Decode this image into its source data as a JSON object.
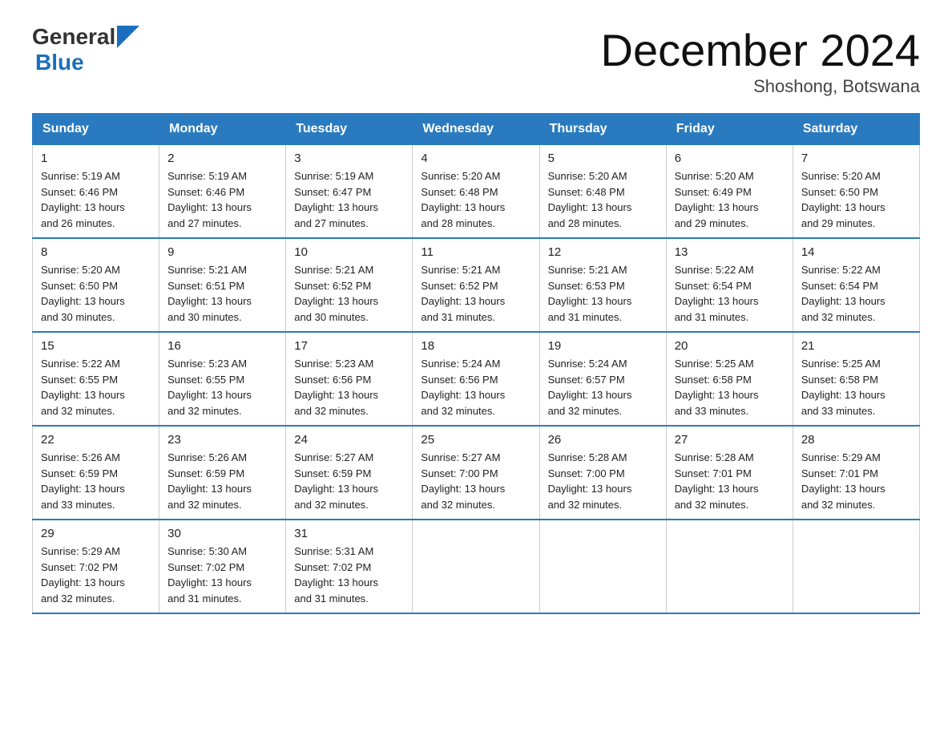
{
  "logo": {
    "general": "General",
    "blue": "Blue"
  },
  "title": "December 2024",
  "subtitle": "Shoshong, Botswana",
  "headers": [
    "Sunday",
    "Monday",
    "Tuesday",
    "Wednesday",
    "Thursday",
    "Friday",
    "Saturday"
  ],
  "weeks": [
    [
      {
        "day": "1",
        "info": "Sunrise: 5:19 AM\nSunset: 6:46 PM\nDaylight: 13 hours\nand 26 minutes."
      },
      {
        "day": "2",
        "info": "Sunrise: 5:19 AM\nSunset: 6:46 PM\nDaylight: 13 hours\nand 27 minutes."
      },
      {
        "day": "3",
        "info": "Sunrise: 5:19 AM\nSunset: 6:47 PM\nDaylight: 13 hours\nand 27 minutes."
      },
      {
        "day": "4",
        "info": "Sunrise: 5:20 AM\nSunset: 6:48 PM\nDaylight: 13 hours\nand 28 minutes."
      },
      {
        "day": "5",
        "info": "Sunrise: 5:20 AM\nSunset: 6:48 PM\nDaylight: 13 hours\nand 28 minutes."
      },
      {
        "day": "6",
        "info": "Sunrise: 5:20 AM\nSunset: 6:49 PM\nDaylight: 13 hours\nand 29 minutes."
      },
      {
        "day": "7",
        "info": "Sunrise: 5:20 AM\nSunset: 6:50 PM\nDaylight: 13 hours\nand 29 minutes."
      }
    ],
    [
      {
        "day": "8",
        "info": "Sunrise: 5:20 AM\nSunset: 6:50 PM\nDaylight: 13 hours\nand 30 minutes."
      },
      {
        "day": "9",
        "info": "Sunrise: 5:21 AM\nSunset: 6:51 PM\nDaylight: 13 hours\nand 30 minutes."
      },
      {
        "day": "10",
        "info": "Sunrise: 5:21 AM\nSunset: 6:52 PM\nDaylight: 13 hours\nand 30 minutes."
      },
      {
        "day": "11",
        "info": "Sunrise: 5:21 AM\nSunset: 6:52 PM\nDaylight: 13 hours\nand 31 minutes."
      },
      {
        "day": "12",
        "info": "Sunrise: 5:21 AM\nSunset: 6:53 PM\nDaylight: 13 hours\nand 31 minutes."
      },
      {
        "day": "13",
        "info": "Sunrise: 5:22 AM\nSunset: 6:54 PM\nDaylight: 13 hours\nand 31 minutes."
      },
      {
        "day": "14",
        "info": "Sunrise: 5:22 AM\nSunset: 6:54 PM\nDaylight: 13 hours\nand 32 minutes."
      }
    ],
    [
      {
        "day": "15",
        "info": "Sunrise: 5:22 AM\nSunset: 6:55 PM\nDaylight: 13 hours\nand 32 minutes."
      },
      {
        "day": "16",
        "info": "Sunrise: 5:23 AM\nSunset: 6:55 PM\nDaylight: 13 hours\nand 32 minutes."
      },
      {
        "day": "17",
        "info": "Sunrise: 5:23 AM\nSunset: 6:56 PM\nDaylight: 13 hours\nand 32 minutes."
      },
      {
        "day": "18",
        "info": "Sunrise: 5:24 AM\nSunset: 6:56 PM\nDaylight: 13 hours\nand 32 minutes."
      },
      {
        "day": "19",
        "info": "Sunrise: 5:24 AM\nSunset: 6:57 PM\nDaylight: 13 hours\nand 32 minutes."
      },
      {
        "day": "20",
        "info": "Sunrise: 5:25 AM\nSunset: 6:58 PM\nDaylight: 13 hours\nand 33 minutes."
      },
      {
        "day": "21",
        "info": "Sunrise: 5:25 AM\nSunset: 6:58 PM\nDaylight: 13 hours\nand 33 minutes."
      }
    ],
    [
      {
        "day": "22",
        "info": "Sunrise: 5:26 AM\nSunset: 6:59 PM\nDaylight: 13 hours\nand 33 minutes."
      },
      {
        "day": "23",
        "info": "Sunrise: 5:26 AM\nSunset: 6:59 PM\nDaylight: 13 hours\nand 32 minutes."
      },
      {
        "day": "24",
        "info": "Sunrise: 5:27 AM\nSunset: 6:59 PM\nDaylight: 13 hours\nand 32 minutes."
      },
      {
        "day": "25",
        "info": "Sunrise: 5:27 AM\nSunset: 7:00 PM\nDaylight: 13 hours\nand 32 minutes."
      },
      {
        "day": "26",
        "info": "Sunrise: 5:28 AM\nSunset: 7:00 PM\nDaylight: 13 hours\nand 32 minutes."
      },
      {
        "day": "27",
        "info": "Sunrise: 5:28 AM\nSunset: 7:01 PM\nDaylight: 13 hours\nand 32 minutes."
      },
      {
        "day": "28",
        "info": "Sunrise: 5:29 AM\nSunset: 7:01 PM\nDaylight: 13 hours\nand 32 minutes."
      }
    ],
    [
      {
        "day": "29",
        "info": "Sunrise: 5:29 AM\nSunset: 7:02 PM\nDaylight: 13 hours\nand 32 minutes."
      },
      {
        "day": "30",
        "info": "Sunrise: 5:30 AM\nSunset: 7:02 PM\nDaylight: 13 hours\nand 31 minutes."
      },
      {
        "day": "31",
        "info": "Sunrise: 5:31 AM\nSunset: 7:02 PM\nDaylight: 13 hours\nand 31 minutes."
      },
      null,
      null,
      null,
      null
    ]
  ]
}
